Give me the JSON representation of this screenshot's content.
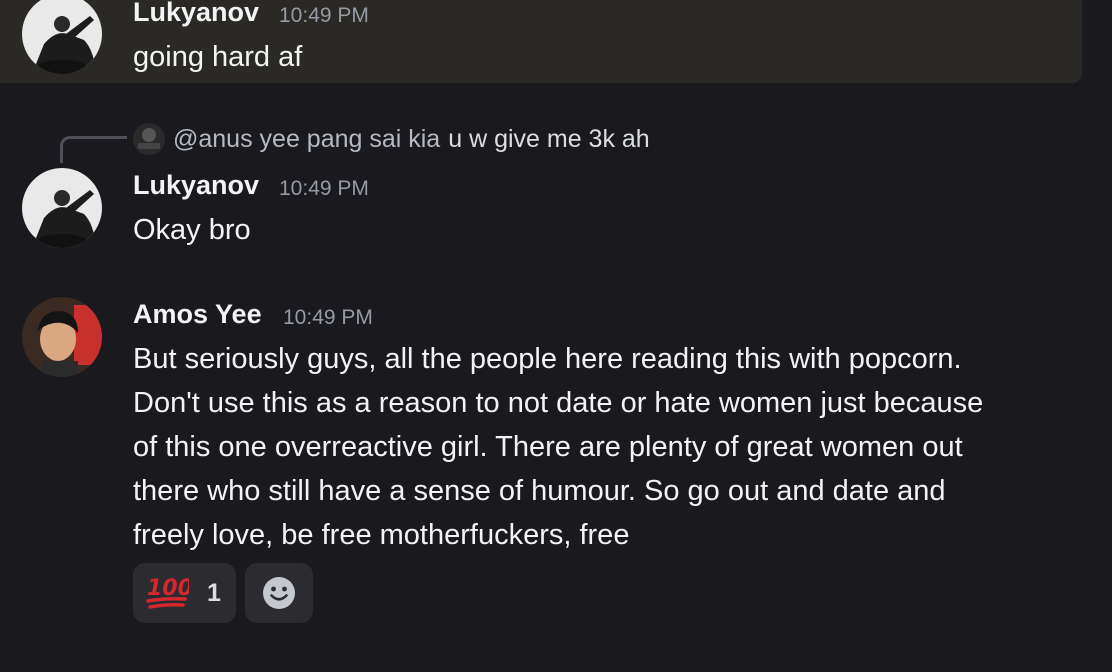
{
  "messages": [
    {
      "author": "Lukyanov",
      "timestamp": "10:49 PM",
      "text": "going hard af"
    },
    {
      "reply": {
        "mention": "@anus yee pang sai kia",
        "text": "u w give me 3k ah"
      },
      "author": "Lukyanov",
      "timestamp": "10:49 PM",
      "text": "Okay bro"
    },
    {
      "author": "Amos Yee",
      "timestamp": "10:49 PM",
      "lines": [
        "But seriously guys, all the people here reading this with popcorn.",
        "Don't use this as a reason to not date or hate women just because",
        "of this one overreactive girl. There are plenty of great women out",
        "there who still have a sense of humour. So go out and date and",
        "freely love, be free motherfuckers, free"
      ],
      "reactions": [
        {
          "emoji": "💯",
          "icon": "hundred-points-icon",
          "count": "1"
        }
      ],
      "add_reaction_icon": "add-reaction-smiley-icon"
    }
  ],
  "colors": {
    "background": "#1a1a1e",
    "highlight": "#2b2925",
    "author": "#f2f3f5",
    "timestamp": "#949ba4",
    "reaction_bg": "#2b2b30",
    "hundred_red": "#d6262e"
  }
}
